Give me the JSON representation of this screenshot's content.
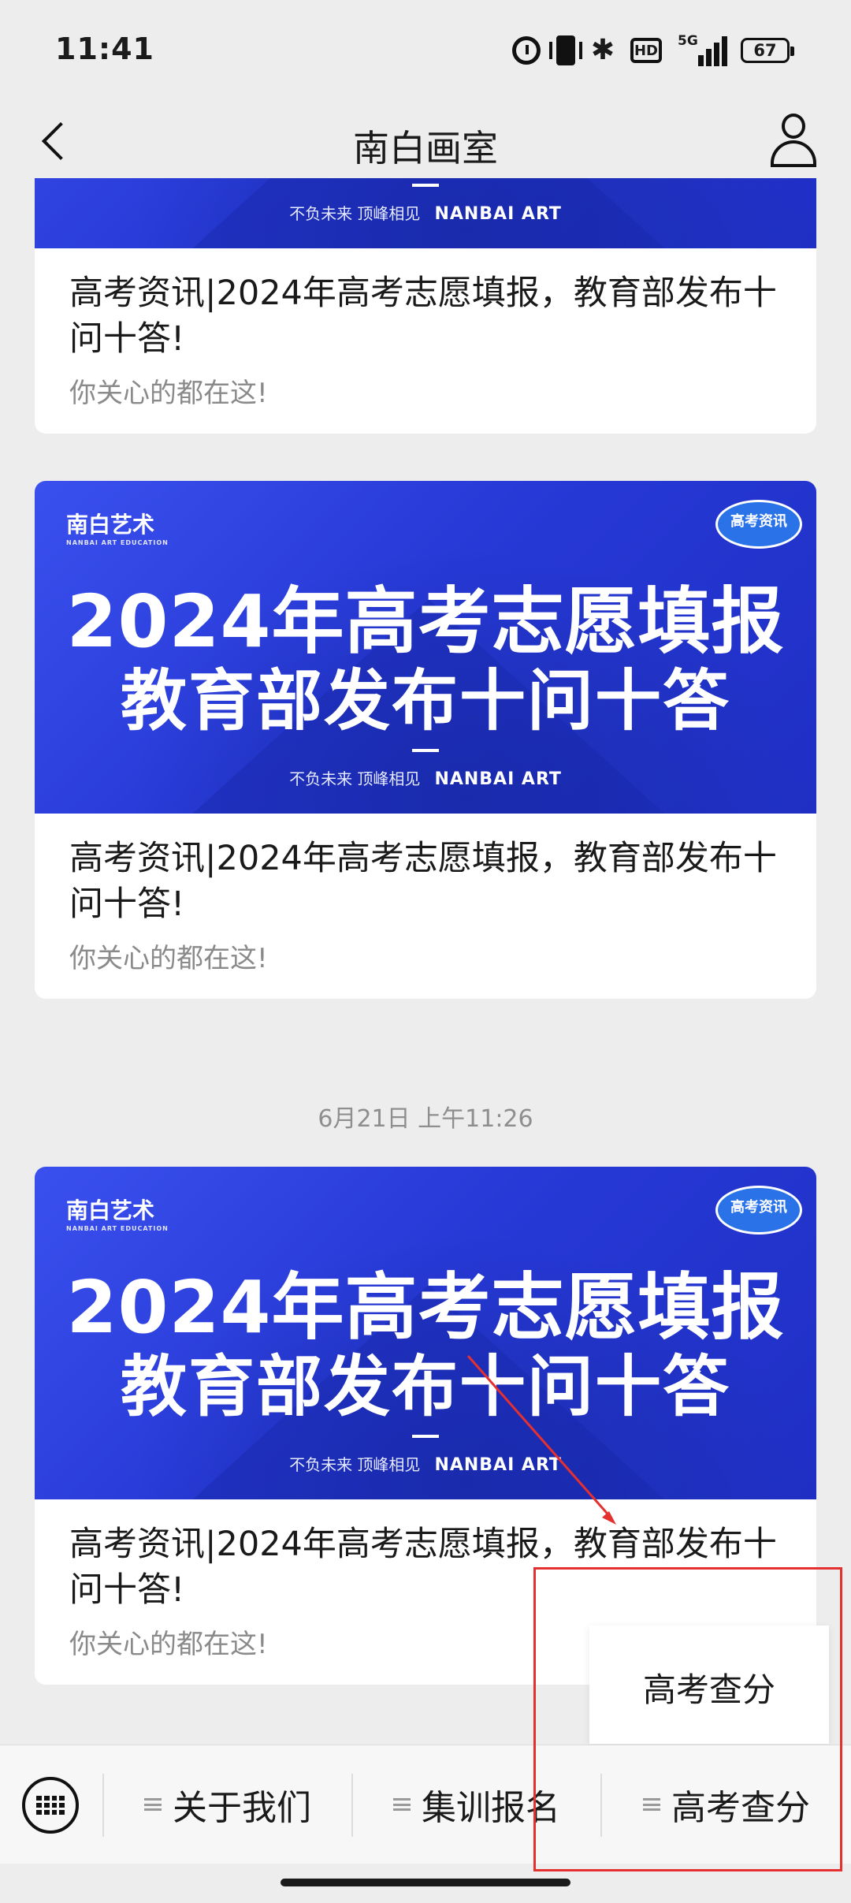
{
  "status_bar": {
    "time": "11:41",
    "network_label": "5G",
    "hd_label": "HD",
    "bluetooth_glyph": "✱",
    "battery": "67"
  },
  "header": {
    "title": "南白画室",
    "back_icon": "chevron-left-icon",
    "profile_icon": "user-icon"
  },
  "banner": {
    "brand": "南白艺术",
    "brand_sub": "NANBAI ART EDUCATION",
    "badge": "高考资讯",
    "line1": "2024年高考志愿填报",
    "line2": "教育部发布十问十答",
    "slogan": "不负未来  顶峰相见",
    "slogan_brand": "NANBAI ART"
  },
  "articles": [
    {
      "title": "高考资讯|2024年高考志愿填报，教育部发布十问十答!",
      "subtitle": "你关心的都在这!"
    },
    {
      "title": "高考资讯|2024年高考志愿填报，教育部发布十问十答!",
      "subtitle": "你关心的都在这!"
    },
    {
      "title": "高考资讯|2024年高考志愿填报，教育部发布十问十答!",
      "subtitle": "你关心的都在这!"
    }
  ],
  "date_separator": "6月21日 上午11:26",
  "popup_menu": {
    "items": [
      "高考查分"
    ]
  },
  "bottom_menu": {
    "keyboard_icon": "keyboard-icon",
    "items": [
      {
        "label": "关于我们"
      },
      {
        "label": "集训报名"
      },
      {
        "label": "高考查分"
      }
    ]
  },
  "colors": {
    "banner_blue": "#2739d6",
    "annotation_red": "#e53030",
    "page_bg": "#ededed"
  }
}
